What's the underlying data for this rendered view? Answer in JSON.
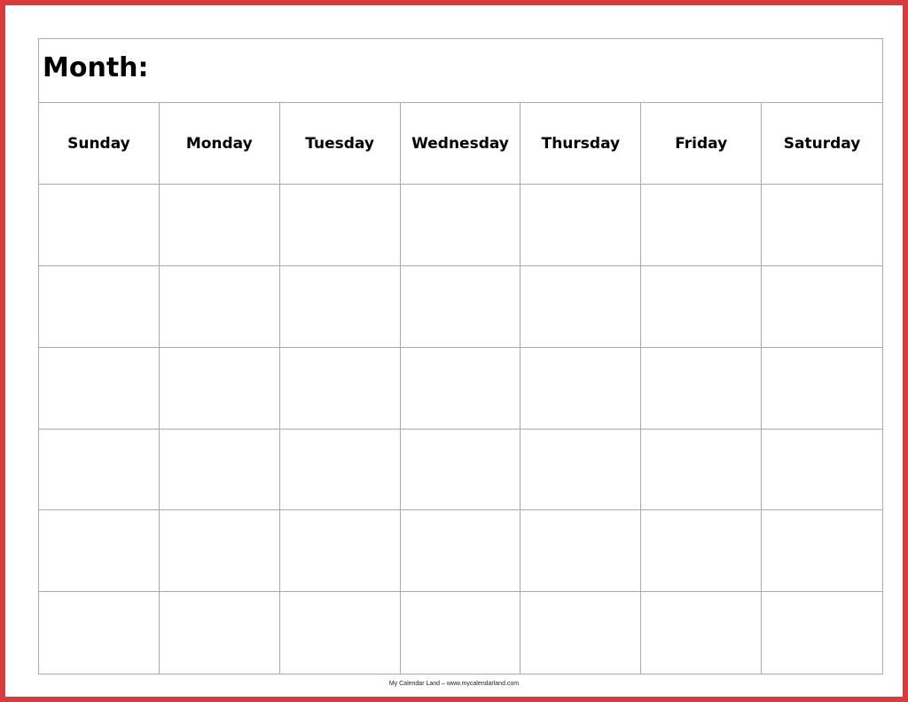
{
  "calendar": {
    "month_label": "Month:",
    "days": [
      "Sunday",
      "Monday",
      "Tuesday",
      "Wednesday",
      "Thursday",
      "Friday",
      "Saturday"
    ],
    "week_rows": 6
  },
  "footer": {
    "credit": "My Calendar Land – www.mycalendarland.com"
  },
  "colors": {
    "border": "#d93a3a",
    "grid": "#aaaaaa"
  }
}
